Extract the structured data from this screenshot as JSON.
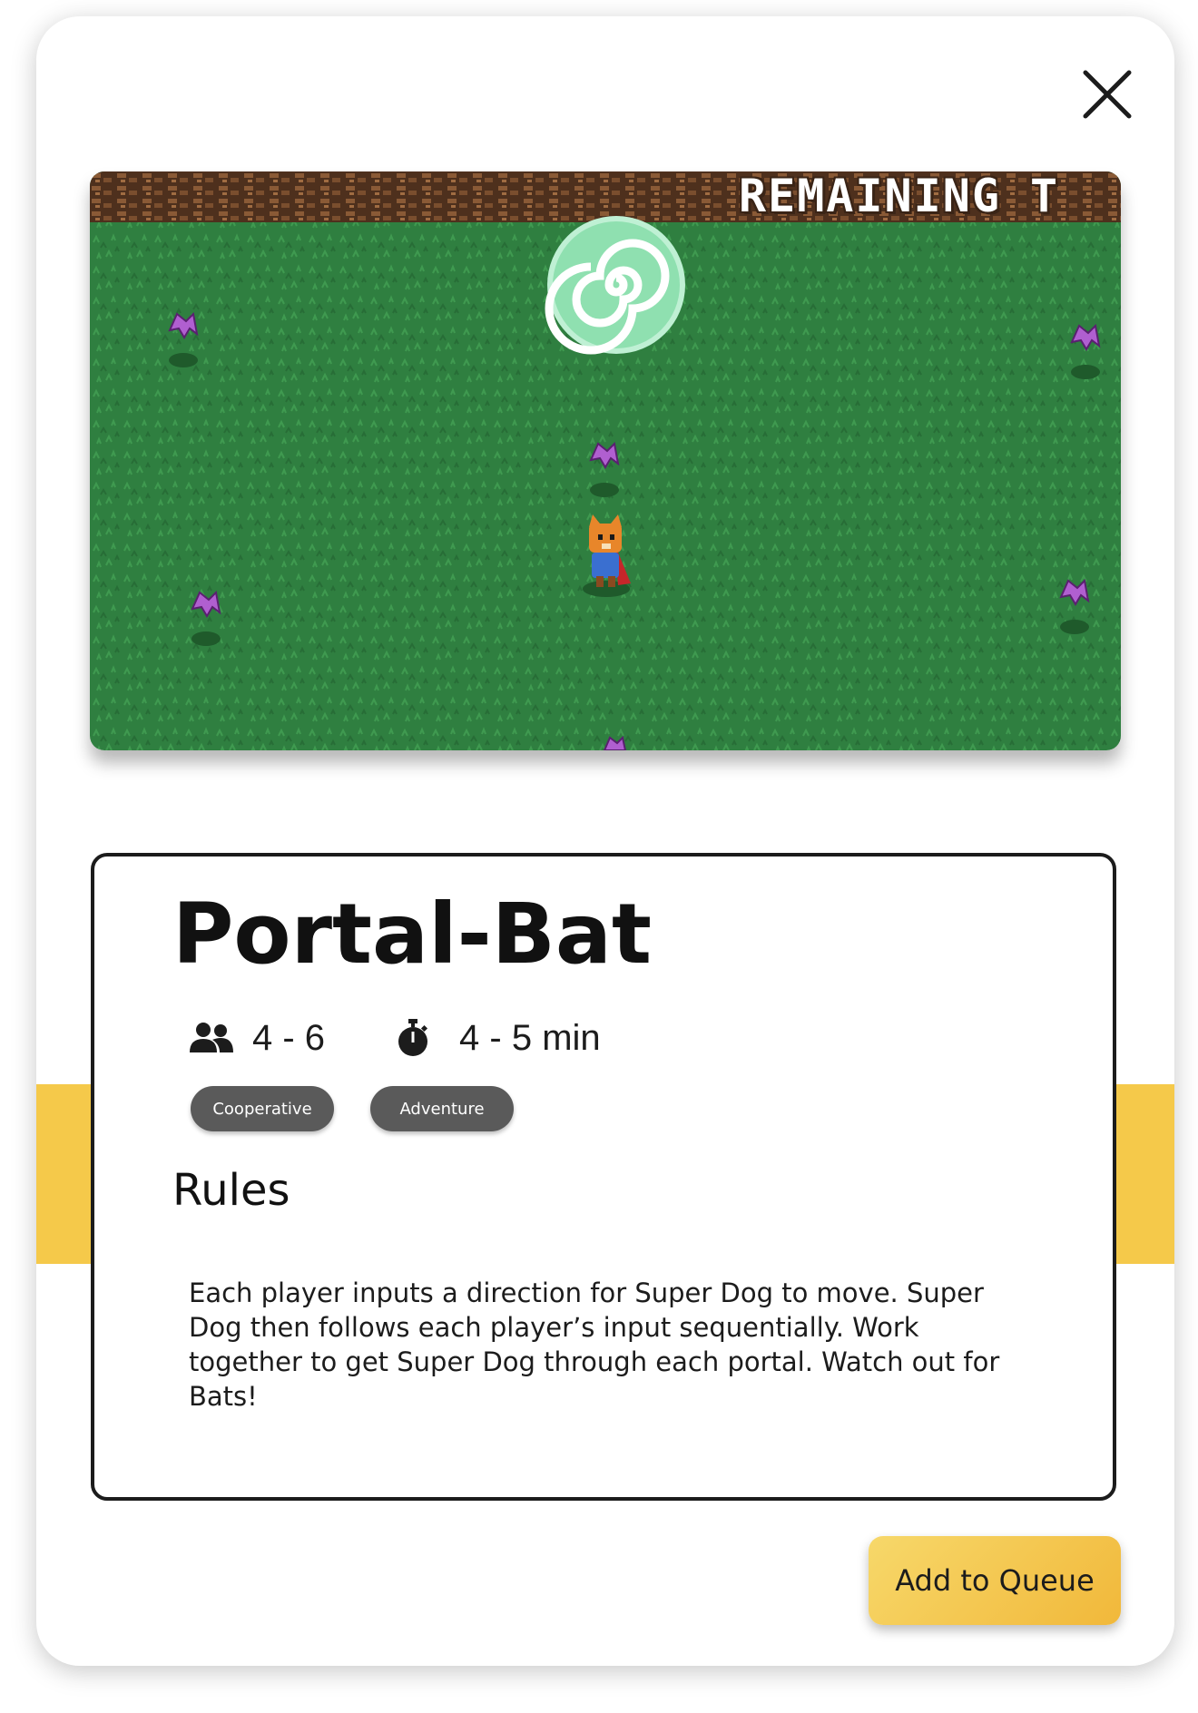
{
  "preview": {
    "hud_text": "REMAINING T",
    "colors": {
      "grass": "#2e7d3f",
      "dirt": "#5a3a24",
      "portal": "#8fe0b0",
      "bat": "#b05fd0"
    }
  },
  "game": {
    "title": "Portal-Bat",
    "players": "4 - 6",
    "duration": "4 - 5 min",
    "tags": [
      "Cooperative",
      "Adventure"
    ]
  },
  "rules": {
    "heading": "Rules",
    "text": "Each player inputs a direction for Super Dog to move.  Super\nDog then follows each player’s input sequentially.  Work\ntogether to get Super Dog through each portal.  Watch out for\nBats!"
  },
  "actions": {
    "add_to_queue": "Add to Queue"
  },
  "colors": {
    "accent": "#f5c94a",
    "tag_bg": "#5a5a5a"
  }
}
